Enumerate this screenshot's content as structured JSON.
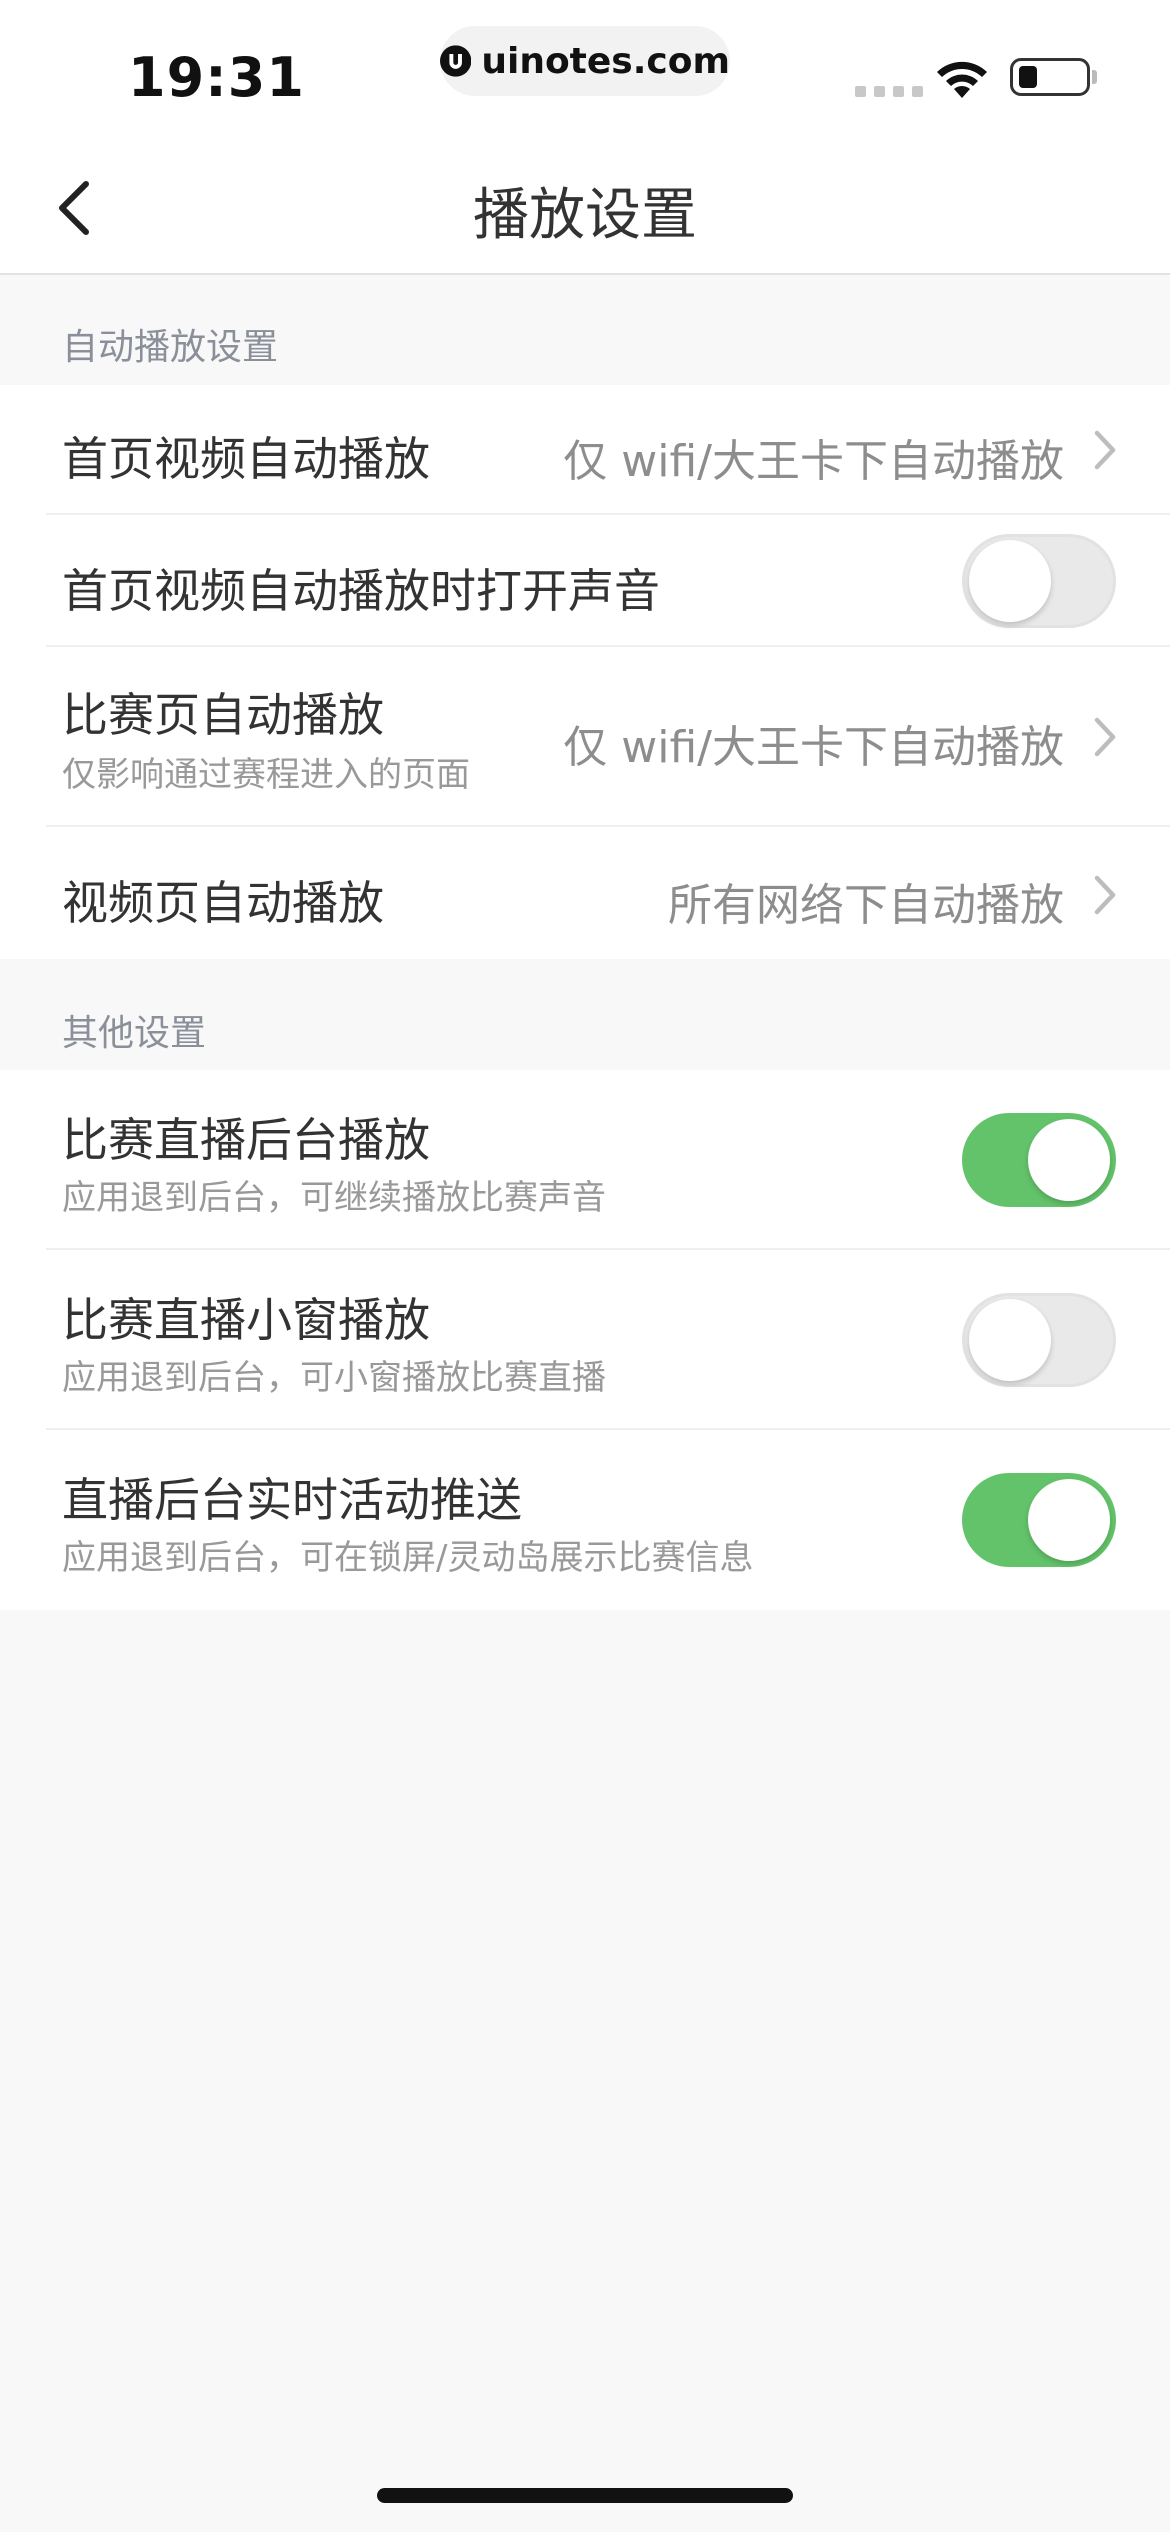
{
  "status_bar": {
    "time": "19:31",
    "url": "uinotes.com"
  },
  "nav": {
    "title": "播放设置"
  },
  "sections": [
    {
      "header": "自动播放设置",
      "rows": [
        {
          "title": "首页视频自动播放",
          "value": "仅 wifi/大王卡下自动播放"
        },
        {
          "title": "首页视频自动播放时打开声音",
          "toggle": false
        },
        {
          "title": "比赛页自动播放",
          "subtitle": "仅影响通过赛程进入的页面",
          "value": "仅 wifi/大王卡下自动播放"
        },
        {
          "title": "视频页自动播放",
          "value": "所有网络下自动播放"
        }
      ]
    },
    {
      "header": "其他设置",
      "rows": [
        {
          "title": "比赛直播后台播放",
          "subtitle": "应用退到后台，可继续播放比赛声音",
          "toggle": true
        },
        {
          "title": "比赛直播小窗播放",
          "subtitle": "应用退到后台，可小窗播放比赛直播",
          "toggle": false
        },
        {
          "title": "直播后台实时活动推送",
          "subtitle": "应用退到后台，可在锁屏/灵动岛展示比赛信息",
          "toggle": true
        }
      ]
    }
  ],
  "colors": {
    "toggle_on": "#63c36a",
    "toggle_off": "#e9e9ea",
    "background": "#f8f8f8"
  },
  "icons": [
    "back-chevron-icon",
    "chevron-right-icon",
    "wifi-icon",
    "battery-icon",
    "uinotes-logo-icon"
  ]
}
